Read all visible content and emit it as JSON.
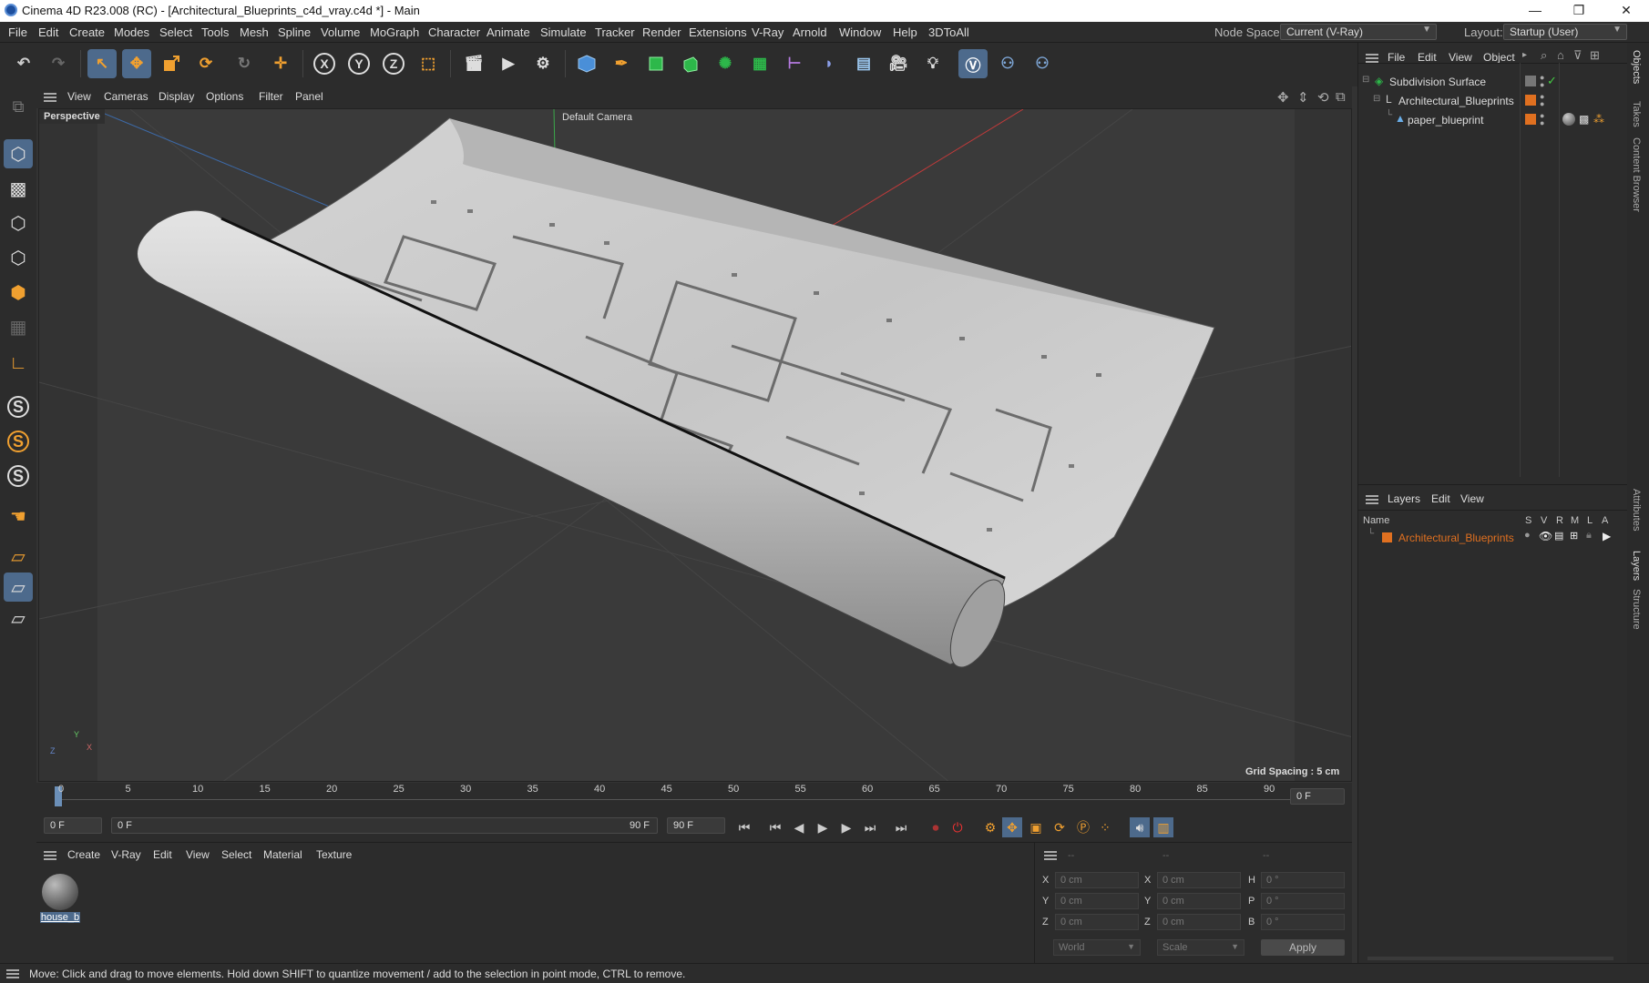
{
  "window": {
    "title": "Cinema 4D R23.008 (RC) - [Architectural_Blueprints_c4d_vray.c4d *] - Main",
    "minimize": "—",
    "maximize": "❐",
    "close": "✕"
  },
  "menubar": {
    "items": [
      "File",
      "Edit",
      "Create",
      "Modes",
      "Select",
      "Tools",
      "Mesh",
      "Spline",
      "Volume",
      "MoGraph",
      "Character",
      "Animate",
      "Simulate",
      "Tracker",
      "Render",
      "Extensions",
      "V-Ray",
      "Arnold",
      "Window",
      "Help",
      "3DToAll"
    ],
    "node_space_label": "Node Space:",
    "node_space_value": "Current (V-Ray)",
    "layout_label": "Layout:",
    "layout_value": "Startup (User)"
  },
  "viewport": {
    "menu": [
      "View",
      "Cameras",
      "Display",
      "Options",
      "Filter",
      "Panel"
    ],
    "view_name": "Perspective",
    "camera": "Default Camera",
    "grid_spacing": "Grid Spacing : 5 cm",
    "axis_x": "X",
    "axis_y": "Y",
    "axis_z": "Z"
  },
  "timeline": {
    "ticks": [
      "0",
      "5",
      "10",
      "15",
      "20",
      "25",
      "30",
      "35",
      "40",
      "45",
      "50",
      "55",
      "60",
      "65",
      "70",
      "75",
      "80",
      "85",
      "90"
    ],
    "current_frame": "0 F",
    "start_field": "0 F",
    "range_start": "0 F",
    "range_end": "90 F",
    "end_field": "90 F"
  },
  "material_panel": {
    "menu": [
      "Create",
      "V-Ray",
      "Edit",
      "View",
      "Select",
      "Material",
      "Texture"
    ],
    "material_name": "house_b"
  },
  "coordinates": {
    "header": [
      "--",
      "--",
      "--"
    ],
    "rows": [
      {
        "l1": "X",
        "v1": "0 cm",
        "l2": "X",
        "v2": "0 cm",
        "l3": "H",
        "v3": "0 °"
      },
      {
        "l1": "Y",
        "v1": "0 cm",
        "l2": "Y",
        "v2": "0 cm",
        "l3": "P",
        "v3": "0 °"
      },
      {
        "l1": "Z",
        "v1": "0 cm",
        "l2": "Z",
        "v2": "0 cm",
        "l3": "B",
        "v3": "0 °"
      }
    ],
    "mode_world": "World",
    "mode_scale": "Scale",
    "apply": "Apply"
  },
  "object_manager": {
    "menu": [
      "File",
      "Edit",
      "View",
      "Object"
    ],
    "objects": [
      {
        "name": "Subdivision Surface"
      },
      {
        "name": "Architectural_Blueprints"
      },
      {
        "name": "paper_blueprint"
      }
    ]
  },
  "layer_manager": {
    "menu": [
      "Layers",
      "Edit",
      "View"
    ],
    "columns": [
      "Name",
      "S",
      "V",
      "R",
      "M",
      "L",
      "A"
    ],
    "layers": [
      {
        "name": "Architectural_Blueprints",
        "color": "#e07020"
      }
    ]
  },
  "side_tabs": [
    "Objects",
    "Takes",
    "Content Browser",
    "Attributes",
    "Layers",
    "Structure"
  ],
  "status": {
    "text": "Move: Click and drag to move elements. Hold down SHIFT to quantize movement / add to the selection in point mode, CTRL to remove."
  },
  "colors": {
    "accent_orange": "#f0a030",
    "selection_blue": "#4d6a8c",
    "layer_orange": "#e07020"
  }
}
